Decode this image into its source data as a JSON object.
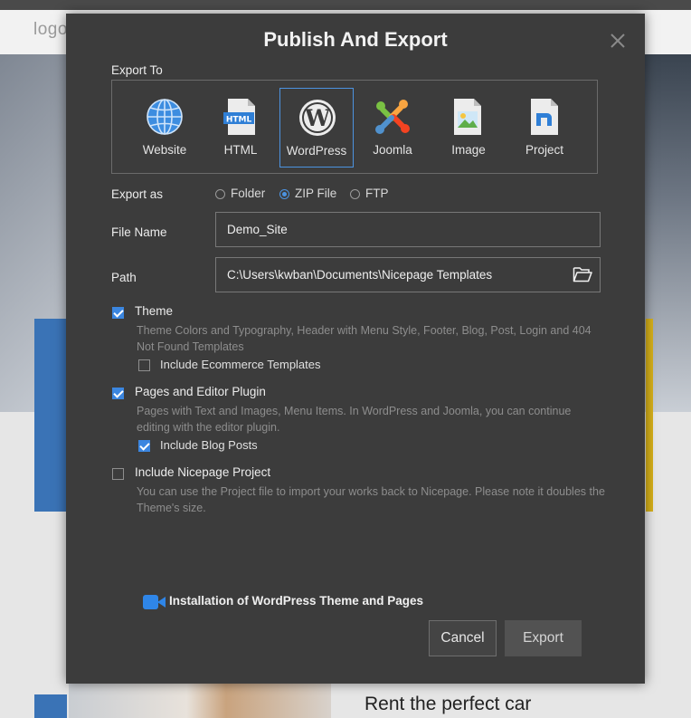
{
  "background": {
    "logo": "logo",
    "tagline": "Rent the perfect car"
  },
  "dialog": {
    "title": "Publish And Export",
    "export_to_label": "Export To",
    "targets": [
      {
        "name": "Website",
        "icon": "globe-icon",
        "selected": false
      },
      {
        "name": "HTML",
        "icon": "html-file-icon",
        "selected": false
      },
      {
        "name": "WordPress",
        "icon": "wordpress-icon",
        "selected": true
      },
      {
        "name": "Joomla",
        "icon": "joomla-icon",
        "selected": false
      },
      {
        "name": "Image",
        "icon": "image-file-icon",
        "selected": false
      },
      {
        "name": "Project",
        "icon": "nicepage-project-icon",
        "selected": false
      }
    ],
    "export_as": {
      "label": "Export as",
      "options": [
        "Folder",
        "ZIP File",
        "FTP"
      ],
      "selected": "ZIP File"
    },
    "file_name": {
      "label": "File Name",
      "value": "Demo_Site"
    },
    "path": {
      "label": "Path",
      "value": "C:\\Users\\kwban\\Documents\\Nicepage Templates"
    },
    "theme": {
      "label": "Theme",
      "checked": true,
      "description": "Theme Colors and Typography, Header with Menu Style, Footer, Blog, Post, Login and 404 Not Found Templates",
      "sub_label": "Include Ecommerce Templates",
      "sub_checked": false
    },
    "pages": {
      "label": "Pages and Editor Plugin",
      "checked": true,
      "description": "Pages with Text and Images, Menu Items. In WordPress and Joomla, you can continue editing with the editor plugin.",
      "sub_label": "Include Blog Posts",
      "sub_checked": true
    },
    "project": {
      "label": "Include Nicepage Project",
      "checked": false,
      "description": "You can use the Project file to import your works back to Nicepage. Please note it doubles the Theme's size."
    },
    "video_link": "Installation of WordPress Theme and Pages",
    "cancel_label": "Cancel",
    "export_label": "Export",
    "colors": {
      "accent": "#3b86e0",
      "dialog_bg": "#3c3c3c",
      "video_icon": "#2f86e8"
    }
  }
}
